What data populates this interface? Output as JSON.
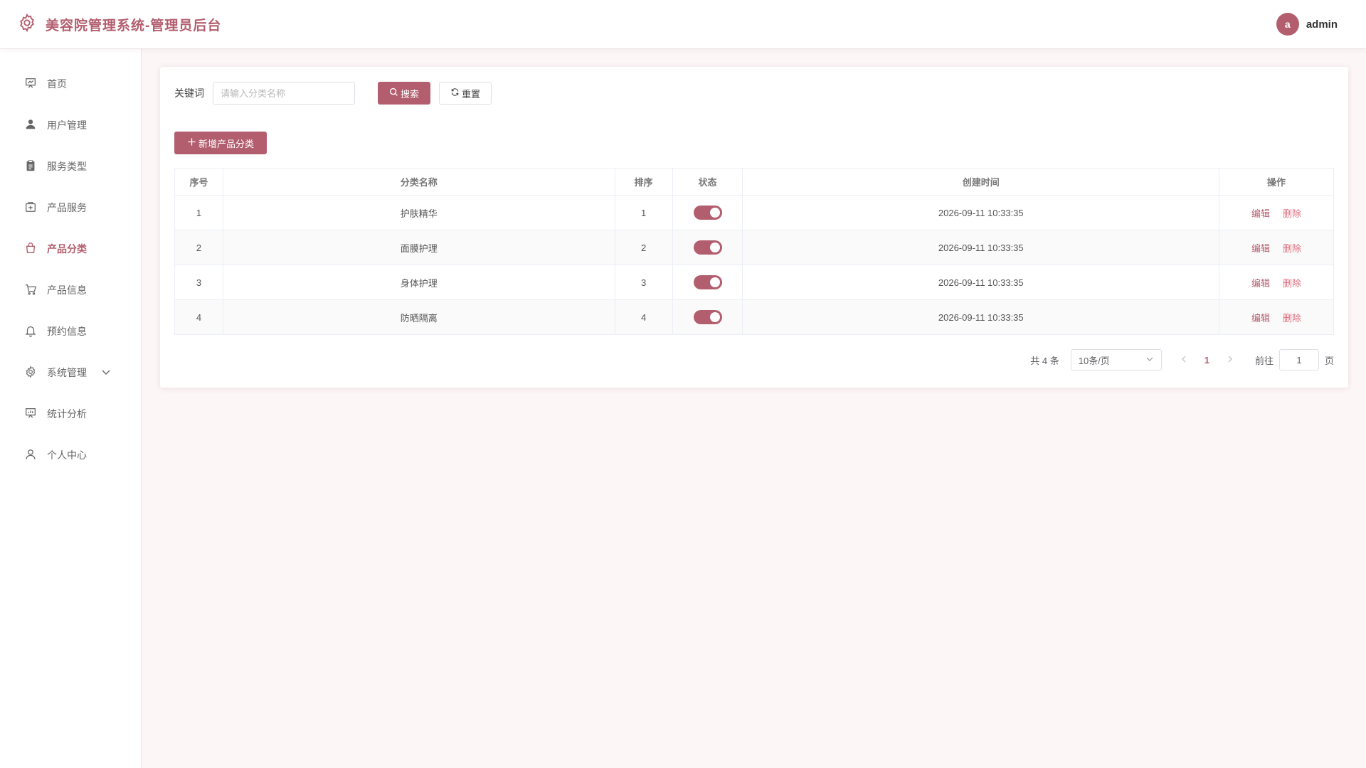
{
  "header": {
    "title": "美容院管理系统-管理员后台",
    "avatar_letter": "a",
    "username": "admin"
  },
  "sidebar": {
    "items": [
      {
        "label": "首页",
        "icon": "dashboard-icon"
      },
      {
        "label": "用户管理",
        "icon": "user-icon"
      },
      {
        "label": "服务类型",
        "icon": "clipboard-icon"
      },
      {
        "label": "产品服务",
        "icon": "medical-box-icon"
      },
      {
        "label": "产品分类",
        "icon": "shopping-bag-icon",
        "active": true
      },
      {
        "label": "产品信息",
        "icon": "cart-icon"
      },
      {
        "label": "预约信息",
        "icon": "bell-icon"
      },
      {
        "label": "系统管理",
        "icon": "gear-icon",
        "expandable": true
      },
      {
        "label": "统计分析",
        "icon": "chart-board-icon"
      },
      {
        "label": "个人中心",
        "icon": "person-icon"
      }
    ]
  },
  "search": {
    "label": "关键词",
    "placeholder": "请输入分类名称",
    "value": "",
    "search_button": "搜索",
    "reset_button": "重置"
  },
  "add_button": "新增产品分类",
  "table": {
    "columns": [
      "序号",
      "分类名称",
      "排序",
      "状态",
      "创建时间",
      "操作"
    ],
    "rows": [
      {
        "index": "1",
        "name": "护肤精华",
        "sort": "1",
        "enabled": true,
        "created": "2026-09-11 10:33:35"
      },
      {
        "index": "2",
        "name": "面膜护理",
        "sort": "2",
        "enabled": true,
        "created": "2026-09-11 10:33:35"
      },
      {
        "index": "3",
        "name": "身体护理",
        "sort": "3",
        "enabled": true,
        "created": "2026-09-11 10:33:35"
      },
      {
        "index": "4",
        "name": "防晒隔离",
        "sort": "4",
        "enabled": true,
        "created": "2026-09-11 10:33:35"
      }
    ],
    "edit_label": "编辑",
    "delete_label": "删除"
  },
  "pagination": {
    "total_text": "共 4 条",
    "page_size": "10条/页",
    "current_page": "1",
    "goto_label": "前往",
    "goto_value": "1",
    "page_suffix": "页"
  },
  "colors": {
    "accent": "#b35e6e",
    "delete": "#e06b7d",
    "background": "#fcf6f6"
  }
}
